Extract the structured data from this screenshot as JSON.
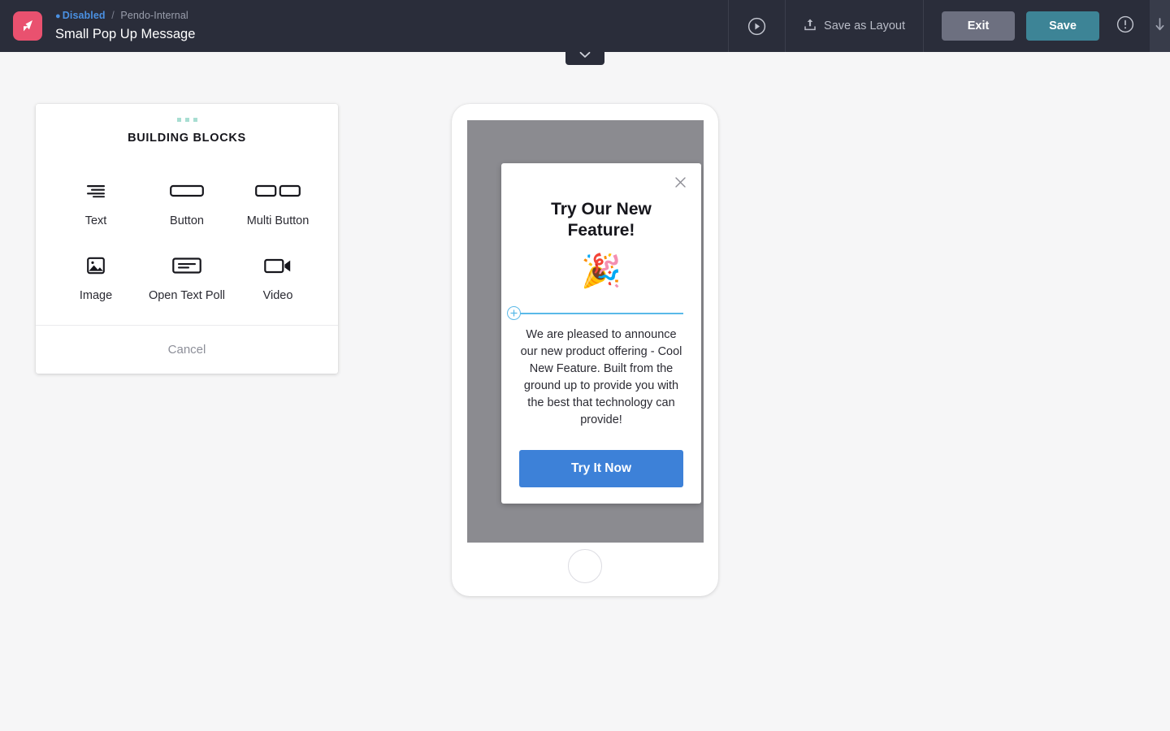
{
  "topbar": {
    "logo_icon": "pendo-arrow-logo",
    "status_label": "Disabled",
    "breadcrumb_separator": "/",
    "app_name": "Pendo-Internal",
    "document_title": "Small Pop Up Message",
    "preview_icon": "play-circle-icon",
    "save_as_layout_label": "Save as Layout",
    "save_as_layout_icon": "upload-icon",
    "exit_label": "Exit",
    "save_label": "Save",
    "warning_icon": "exclamation-circle-icon",
    "scroll_down_icon": "arrow-down-icon",
    "collapse_icon": "chevron-down-icon",
    "colors": {
      "bar_bg": "#2a2d3a",
      "rail_bg": "#383c4a",
      "status_blue": "#4a90e2",
      "logo_pink": "#e9516f",
      "exit_gray": "#6d7080",
      "save_teal": "#3d8496"
    }
  },
  "building_blocks": {
    "heading": "BUILDING BLOCKS",
    "dots_color": "#a8ded2",
    "items": [
      {
        "label": "Text",
        "icon": "text-lines-icon"
      },
      {
        "label": "Button",
        "icon": "button-rect-icon"
      },
      {
        "label": "Multi Button",
        "icon": "multi-button-icon"
      },
      {
        "label": "Image",
        "icon": "image-icon"
      },
      {
        "label": "Open Text Poll",
        "icon": "open-text-poll-icon"
      },
      {
        "label": "Video",
        "icon": "video-camera-icon"
      }
    ],
    "cancel_label": "Cancel"
  },
  "preview": {
    "device": "phone",
    "overlay_color": "#8b8b90",
    "popup": {
      "close_icon": "close-x-icon",
      "title": "Try Our New Feature!",
      "emoji": "🎉",
      "insert_line": {
        "icon": "plus-circle-icon",
        "color": "#5ab9e8"
      },
      "body": "We are pleased to announce our new product offering - Cool New Feature. Built from the ground up to provide you with the best that technology can provide!",
      "cta_label": "Try It Now",
      "cta_color": "#3d81d8"
    },
    "home_button_icon": "home-button-circle"
  }
}
